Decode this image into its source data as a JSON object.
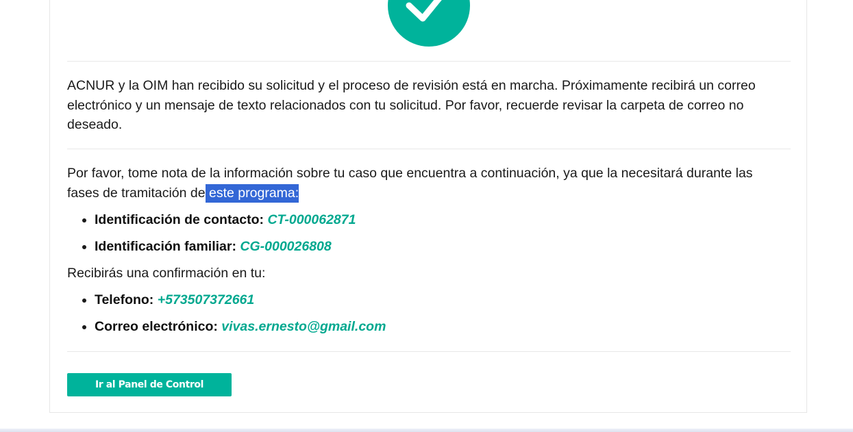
{
  "success": {
    "icon": "checkmark-icon",
    "accent_color": "#00b39b",
    "message": "ACNUR y la OIM han recibido su solicitud y el proceso de revisión está en marcha. Próximamente recibirá un correo electrónico y un mensaje de texto relacionados con tu solicitud. Por favor, recuerde revisar la carpeta de correo no deseado."
  },
  "case_info": {
    "intro": "Por favor, tome nota de la información sobre tu caso que encuentra a continuación, ya que la necesitará durante las fases de tramitación de",
    "highlighted": " este programa:",
    "items": [
      {
        "label": "Identificación de contacto:",
        "value": "CT-000062871"
      },
      {
        "label": "Identificación familiar:",
        "value": "CG-000026808"
      }
    ]
  },
  "confirmation": {
    "intro": "Recibirás una confirmación en tu:",
    "items": [
      {
        "label": "Telefono:",
        "value": "+573507372661"
      },
      {
        "label": "Correo electrónico:",
        "value": "vivas.ernesto@gmail.com"
      }
    ]
  },
  "actions": {
    "dashboard_label": "Ir al Panel de Control"
  },
  "selection_color": "#3367d6"
}
